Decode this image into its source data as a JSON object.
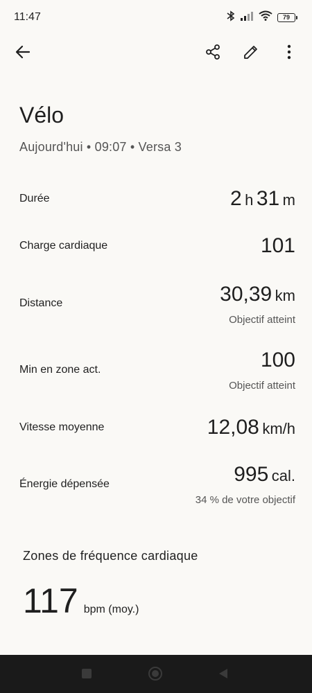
{
  "status_bar": {
    "time": "11:47",
    "battery": "79",
    "icons": [
      "bluetooth-icon",
      "signal-icon",
      "wifi-icon",
      "battery-icon"
    ]
  },
  "toolbar": {
    "icons": [
      "back-arrow-icon",
      "share-icon",
      "edit-pencil-icon",
      "more-vert-icon"
    ]
  },
  "activity": {
    "title": "Vélo",
    "subtitle": "Aujourd'hui • 09:07 • Versa 3"
  },
  "stats": {
    "duration": {
      "label": "Durée",
      "hours": "2",
      "h_unit": "h",
      "minutes": "31",
      "m_unit": "m"
    },
    "heart_load": {
      "label": "Charge cardiaque",
      "value": "101"
    },
    "distance": {
      "label": "Distance",
      "value": "30,39",
      "unit": "km",
      "note": "Objectif atteint"
    },
    "active_zone": {
      "label": "Min en zone act.",
      "value": "100",
      "note": "Objectif atteint"
    },
    "avg_speed": {
      "label": "Vitesse moyenne",
      "value": "12,08",
      "unit": "km/h"
    },
    "energy": {
      "label": "Énergie dépensée",
      "value": "995",
      "unit": "cal.",
      "note": "34 % de votre objectif"
    }
  },
  "heart_zones": {
    "title": "Zones de fréquence cardiaque",
    "avg_bpm": "117",
    "unit": "bpm (moy.)"
  },
  "colors": {
    "background": "#faf9f6",
    "text": "#1f1f1f",
    "secondary_text": "#555555",
    "nav_bar": "#1a1a1a"
  }
}
